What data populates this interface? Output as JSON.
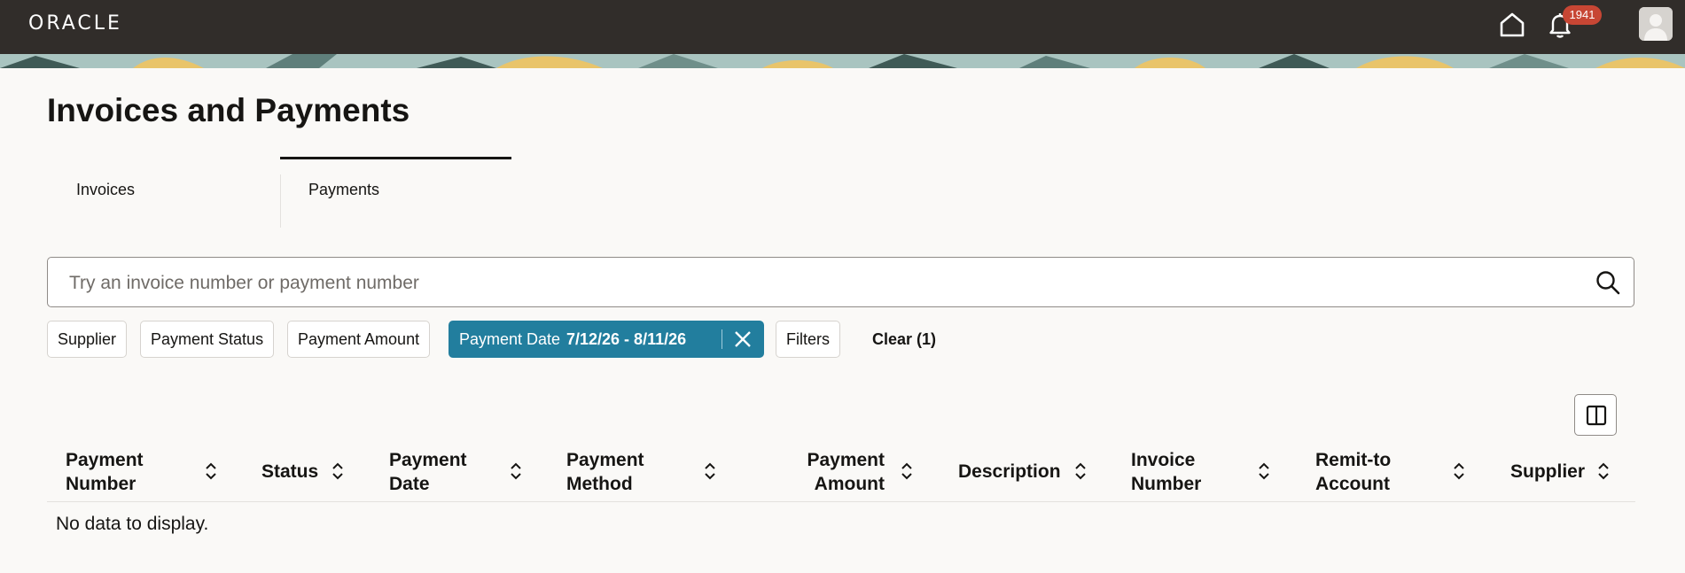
{
  "header": {
    "logo": "ORACLE",
    "notifications_count": "1941"
  },
  "page": {
    "title": "Invoices and Payments"
  },
  "tabs": [
    {
      "label": "Invoices",
      "selected": false
    },
    {
      "label": "Payments",
      "selected": true
    }
  ],
  "search": {
    "value": "",
    "placeholder": "Try an invoice number or payment number"
  },
  "filters": {
    "chips": [
      "Supplier",
      "Payment Status",
      "Payment Amount"
    ],
    "active_chip": {
      "label": "Payment Date",
      "value": "7/12/26 - 8/11/26"
    },
    "filters_label": "Filters",
    "clear_label": "Clear (1)"
  },
  "table": {
    "columns": [
      {
        "line1": "Payment",
        "line2": "Number"
      },
      {
        "line1": "Status",
        "line2": ""
      },
      {
        "line1": "Payment",
        "line2": "Date"
      },
      {
        "line1": "Payment",
        "line2": "Method"
      },
      {
        "line1": "Payment",
        "line2": "Amount"
      },
      {
        "line1": "Description",
        "line2": ""
      },
      {
        "line1": "Invoice",
        "line2": "Number"
      },
      {
        "line1": "Remit-to",
        "line2": "Account"
      },
      {
        "line1": "Supplier",
        "line2": ""
      }
    ],
    "empty_message": "No data to display."
  },
  "icons": {
    "home": "home-icon",
    "notifications": "bell-icon",
    "search": "search-icon",
    "remove_filter": "close-icon",
    "columns": "columns-icon",
    "sort": "sort-icon"
  },
  "colors": {
    "topbar": "#312d2a",
    "accent": "#227e9e",
    "badge": "#c74634",
    "page_bg": "#faf9f7"
  }
}
